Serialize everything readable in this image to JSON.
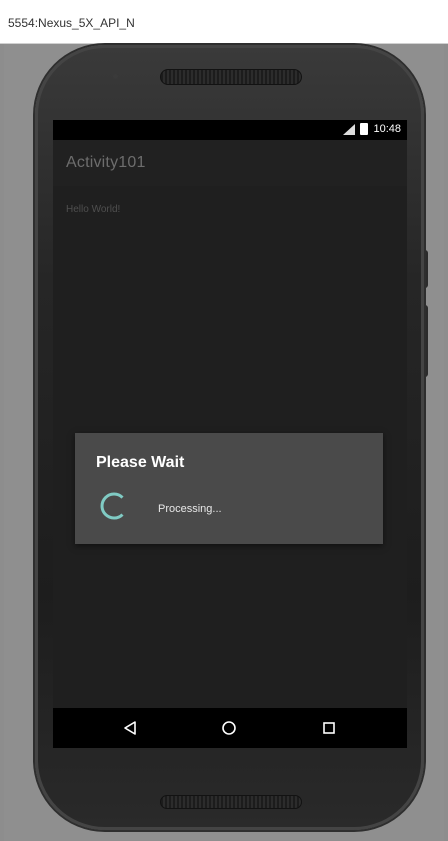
{
  "window": {
    "title": "5554:Nexus_5X_API_N"
  },
  "statusbar": {
    "time": "10:48",
    "icons": [
      "signal-icon",
      "battery-icon"
    ]
  },
  "app": {
    "title": "Activity101",
    "content_text": "Hello World!"
  },
  "dialog": {
    "title": "Please Wait",
    "message": "Processing...",
    "spinner_color": "#80cbc4"
  },
  "navbar": {
    "buttons": [
      "back-icon",
      "home-icon",
      "recents-icon"
    ]
  },
  "colors": {
    "dialog_bg": "#4a4a4a",
    "screen_bg": "#1e1e1e",
    "spinner": "#80cbc4"
  }
}
